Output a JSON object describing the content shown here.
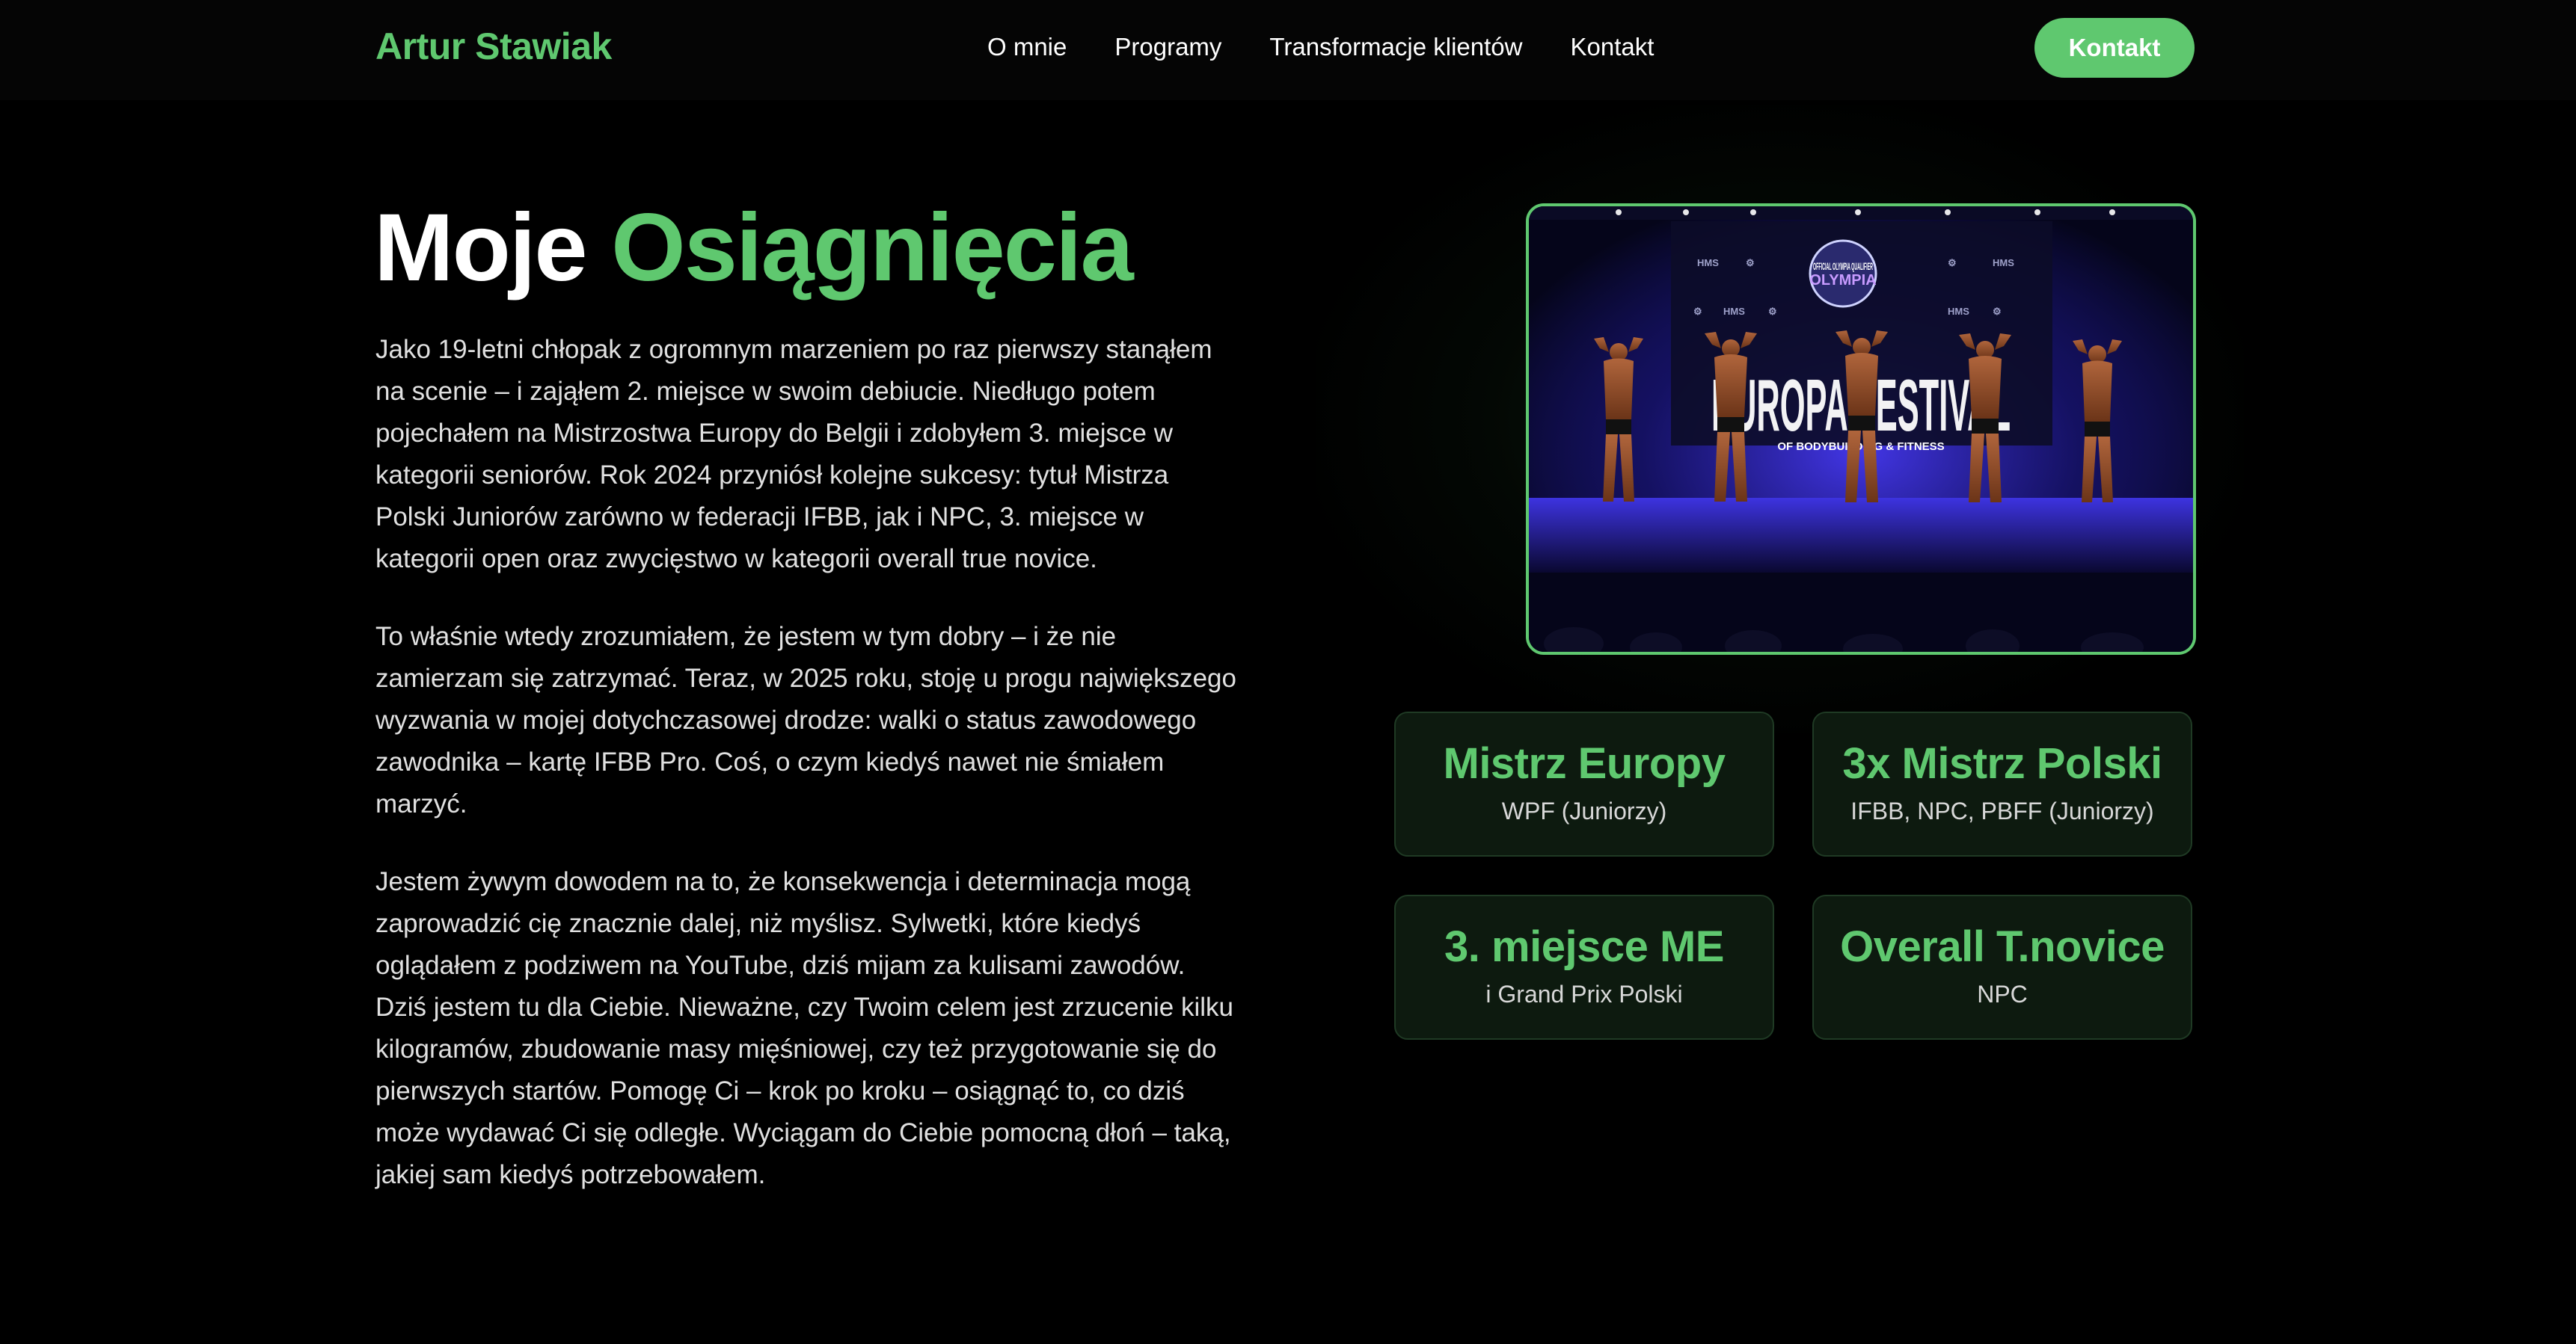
{
  "nav": {
    "brand": "Artur Stawiak",
    "links": [
      "O mnie",
      "Programy",
      "Transformacje klientów",
      "Kontakt"
    ],
    "cta": "Kontakt"
  },
  "hero": {
    "title_white": "Moje",
    "title_green": "Osiągnięcia",
    "paragraphs": [
      "Jako 19-letni chłopak z ogromnym marzeniem po raz pierwszy stanąłem na scenie – i zająłem 2. miejsce w swoim debiucie. Niedługo potem pojechałem na Mistrzostwa Europy do Belgii i zdobyłem 3. miejsce w kategorii seniorów. Rok 2024 przyniósł kolejne sukcesy: tytuł Mistrza Polski Juniorów zarówno w federacji IFBB, jak i NPC, 3. miejsce w kategorii open oraz zwycięstwo w kategorii overall true novice.",
      "To właśnie wtedy zrozumiałem, że jestem w tym dobry – i że nie zamierzam się zatrzymać. Teraz, w 2025 roku, stoję u progu największego wyzwania w mojej dotychczasowej drodze: walki o status zawodowego zawodnika – kartę IFBB Pro. Coś, o czym kiedyś nawet nie śmiałem marzyć.",
      "Jestem żywym dowodem na to, że konsekwencja i determinacja mogą zaprowadzić cię znacznie dalej, niż myślisz. Sylwetki, które kiedyś oglądałem z podziwem na YouTube, dziś mijam za kulisami zawodów. Dziś jestem tu dla Ciebie. Nieważne, czy Twoim celem jest zrzucenie kilku kilogramów, zbudowanie masy mięśniowej, czy też przygotowanie się do pierwszych startów. Pomogę Ci – krok po kroku – osiągnąć to, co dziś może wydawać Ci się odległe. Wyciągam do Ciebie pomocną dłoń – taką, jakiej sam kiedyś potrzebowałem."
    ]
  },
  "photo": {
    "banner_top": "OFFICIAL OLYMPIA QUALIFIER",
    "banner_main": "EUROPA FESTIVAL",
    "banner_sub": "OF BODYBUILDING & FITNESS"
  },
  "stats": [
    {
      "title": "Mistrz Europy",
      "sub": "WPF (Juniorzy)"
    },
    {
      "title": "3x Mistrz Polski",
      "sub": "IFBB, NPC, PBFF (Juniorzy)"
    },
    {
      "title": "3. miejsce ME",
      "sub": "i Grand Prix Polski"
    },
    {
      "title": "Overall T.novice",
      "sub": "NPC"
    }
  ],
  "colors": {
    "accent": "#5fc86f",
    "background": "#000000",
    "card_bg": "#0d1a0f",
    "stage_light": "#3b2fd6"
  }
}
